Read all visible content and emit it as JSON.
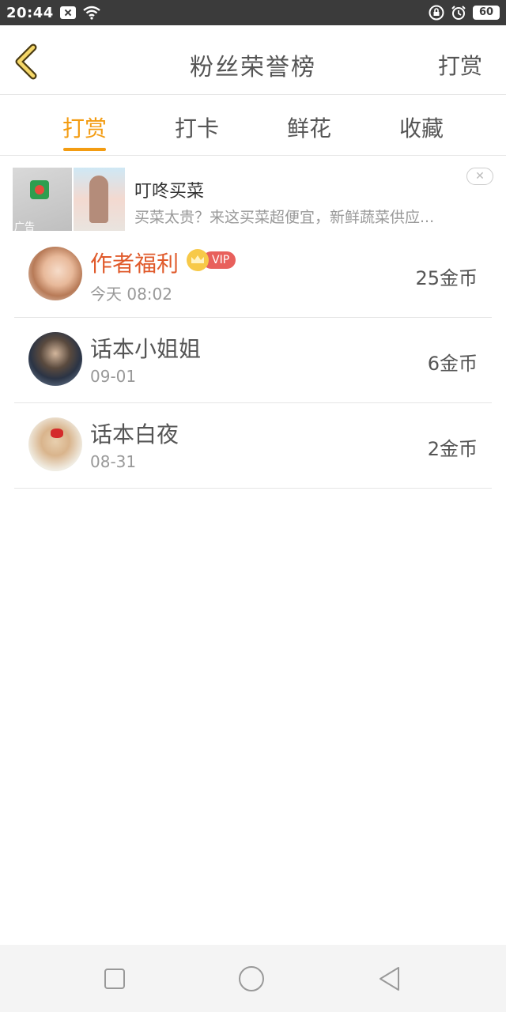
{
  "status_bar": {
    "time": "20:44",
    "battery": "60"
  },
  "header": {
    "title": "粉丝荣誉榜",
    "action": "打赏"
  },
  "tabs": [
    {
      "label": "打赏",
      "active": true
    },
    {
      "label": "打卡",
      "active": false
    },
    {
      "label": "鲜花",
      "active": false
    },
    {
      "label": "收藏",
      "active": false
    }
  ],
  "ad": {
    "title": "叮咚买菜",
    "description": "买菜太贵？来这买菜超便宜，新鲜蔬菜供应...",
    "label": "广告"
  },
  "rewards": [
    {
      "name": "作者福利",
      "vip": true,
      "vip_text": "VIP",
      "date": "今天 08:02",
      "amount": "25金币"
    },
    {
      "name": "话本小姐姐",
      "vip": false,
      "date": "09-01",
      "amount": "6金币"
    },
    {
      "name": "话本白夜",
      "vip": false,
      "date": "08-31",
      "amount": "2金币"
    }
  ],
  "colors": {
    "accent": "#f39c12",
    "highlight_name": "#e05a2b",
    "vip": "#e8605c"
  }
}
